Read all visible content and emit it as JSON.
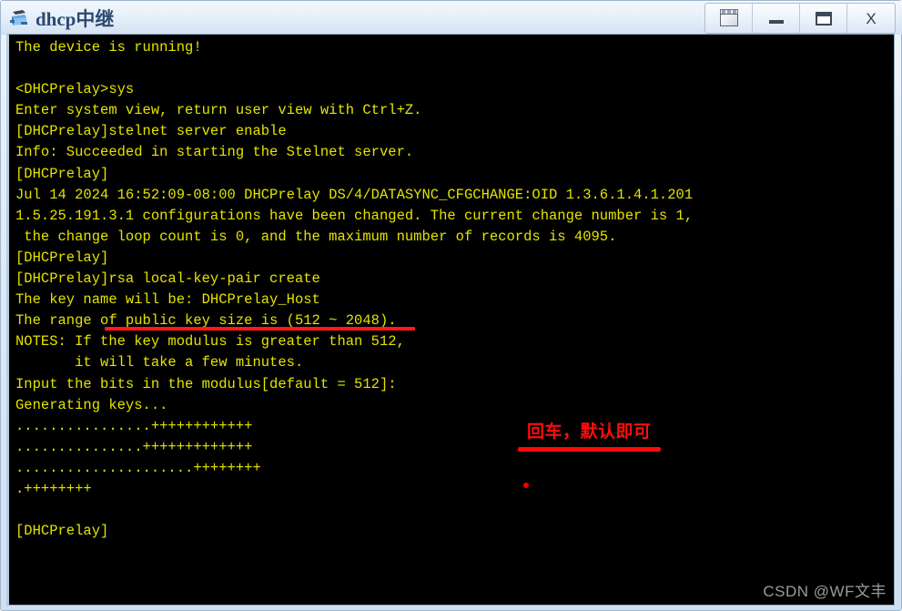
{
  "window": {
    "title": "dhcp中继",
    "icon": "network-switch-icon",
    "controls": [
      {
        "name": "screen-restore-button",
        "label": "",
        "icon": "screen-icon"
      },
      {
        "name": "minimize-button",
        "label": "–",
        "icon": "minimize-icon"
      },
      {
        "name": "maximize-button",
        "label": "",
        "icon": "maximize-icon"
      },
      {
        "name": "close-button",
        "label": "X",
        "icon": "close-icon"
      }
    ],
    "title_color": "#2b4a72",
    "titlebar_color": "#e6eff9"
  },
  "terminal": {
    "background_color": "#000000",
    "text_color": "#e3e300",
    "font_size_px": 15.5,
    "lines": [
      "The device is running!",
      "",
      "<DHCPrelay>sys",
      "Enter system view, return user view with Ctrl+Z.",
      "[DHCPrelay]stelnet server enable",
      "Info: Succeeded in starting the Stelnet server.",
      "[DHCPrelay]",
      "Jul 14 2024 16:52:09-08:00 DHCPrelay DS/4/DATASYNC_CFGCHANGE:OID 1.3.6.1.4.1.201",
      "1.5.25.191.3.1 configurations have been changed. The current change number is 1,",
      " the change loop count is 0, and the maximum number of records is 4095.",
      "[DHCPrelay]",
      "[DHCPrelay]rsa local-key-pair create",
      "The key name will be: DHCPrelay_Host",
      "The range of public key size is (512 ~ 2048).",
      "NOTES: If the key modulus is greater than 512,",
      "       it will take a few minutes.",
      "Input the bits in the modulus[default = 512]:",
      "Generating keys...",
      "................++++++++++++",
      "...............+++++++++++++",
      ".....................++++++++",
      ".++++++++",
      "",
      "[DHCPrelay]"
    ]
  },
  "annotations": {
    "command_underline": {
      "name": "command-underline",
      "target_text": "rsa local-key-pair create",
      "color": "#ff1a1a"
    },
    "note": {
      "name": "annotation-note",
      "text": "回车，默认即可",
      "color": "#ff0d0d"
    },
    "note_underline": {
      "name": "annotation-underline",
      "color": "#fa0b0b"
    },
    "dot_mark": {
      "name": "red-dot-mark",
      "color": "#ee0000"
    }
  },
  "watermark": {
    "text": "CSDN @WF文丰",
    "color": "#9a9a9a"
  }
}
